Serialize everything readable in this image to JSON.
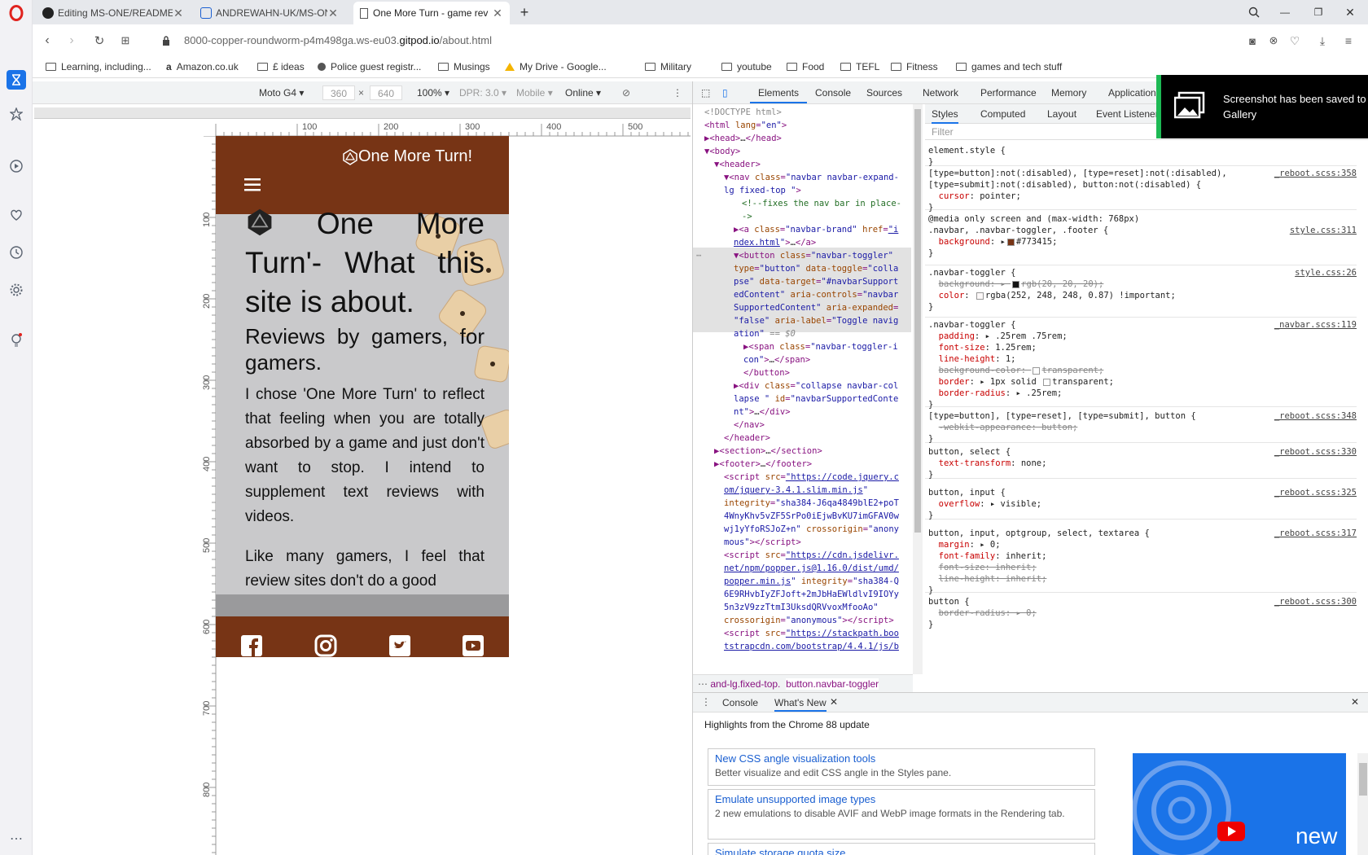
{
  "browser": {
    "tabs": [
      {
        "title": "Editing MS-ONE/README",
        "icon": "github-icon"
      },
      {
        "title": "ANDREWAHN-UK/MS-ONE",
        "icon": "github-icon"
      },
      {
        "title": "One More Turn - game rev",
        "icon": "page-icon",
        "active": true
      }
    ],
    "url_prefix": "8000-copper-roundworm-p4m498ga.ws-eu03.",
    "url_domain": "gitpod.io",
    "url_path": "/about.html",
    "bookmarks": [
      "Learning, including...",
      "Amazon.co.uk",
      "£ ideas",
      "Police guest registr...",
      "Musings",
      "My Drive - Google...",
      "Military",
      "youtube",
      "Food",
      "TEFL",
      "Fitness",
      "games and tech stuff"
    ]
  },
  "device_toolbar": {
    "device": "Moto G4",
    "width": "360",
    "height": "640",
    "zoom": "100%",
    "dpr": "DPR: 3.0",
    "mode": "Mobile",
    "network": "Online",
    "ruler_labels": [
      "100",
      "200",
      "300",
      "400",
      "500"
    ],
    "v_ruler_labels": [
      "100",
      "200",
      "300",
      "400",
      "500",
      "600",
      "700",
      "800"
    ]
  },
  "site": {
    "brand": "One More Turn!",
    "heading": "One More Turn'- What this site is about.",
    "subheading": "Reviews by gamers, for gamers.",
    "para1": "I chose 'One More Turn' to reflect that feeling when you are totally absorbed by a game and just don't want to stop. I intend to supplement text reviews with videos.",
    "para2": "Like many gamers, I feel that review sites don't do a good"
  },
  "devtools": {
    "tabs": [
      "Elements",
      "Console",
      "Sources",
      "Network",
      "Performance",
      "Memory",
      "Application"
    ],
    "style_tabs": [
      "Styles",
      "Computed",
      "Layout",
      "Event Listeners"
    ],
    "filter_placeholder": "Filter",
    "breadcrumb": [
      "and-lg.fixed-top.",
      "button.navbar-toggler"
    ],
    "drawer_tabs": [
      "Console",
      "What's New"
    ],
    "drawer_title": "Highlights from the Chrome 88 update",
    "cards": [
      {
        "title": "New CSS angle visualization tools",
        "desc": "Better visualize and edit CSS angle in the Styles pane."
      },
      {
        "title": "Emulate unsupported image types",
        "desc": "2 new emulations to disable AVIF and WebP image formats in the Rendering tab."
      },
      {
        "title": "Simulate storage quota size",
        "desc": ""
      }
    ],
    "video_label": "new"
  },
  "toast": {
    "text": "Screenshot has been saved to Gallery"
  },
  "colors": {
    "brand": "#773415",
    "accent": "#1a73e8"
  }
}
